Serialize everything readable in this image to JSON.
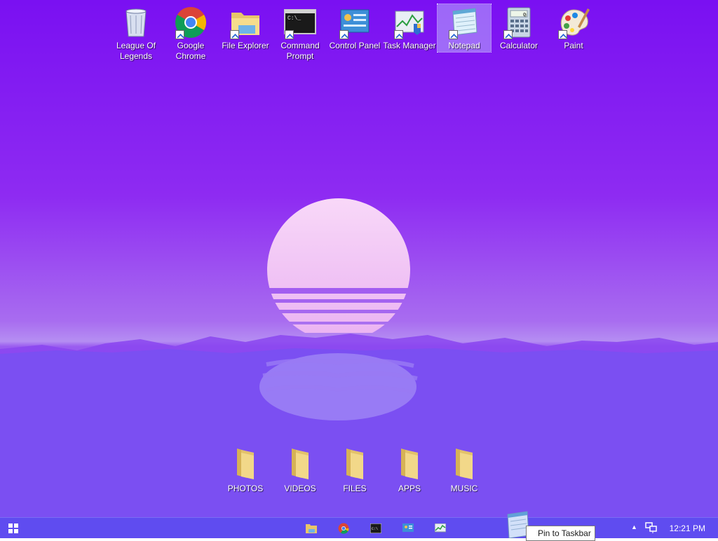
{
  "desktop": {
    "icons": [
      {
        "label": "League Of Legends",
        "icon": "recycle-bin-icon"
      },
      {
        "label": "Google Chrome",
        "icon": "chrome-icon"
      },
      {
        "label": "File Explorer",
        "icon": "file-explorer-icon"
      },
      {
        "label": "Command Prompt",
        "icon": "command-prompt-icon"
      },
      {
        "label": "Control Panel",
        "icon": "control-panel-icon"
      },
      {
        "label": "Task Manager",
        "icon": "task-manager-icon"
      },
      {
        "label": "Notepad",
        "icon": "notepad-icon",
        "selected": true
      },
      {
        "label": "Calculator",
        "icon": "calculator-icon"
      },
      {
        "label": "Paint",
        "icon": "paint-icon"
      }
    ],
    "folders": [
      {
        "label": "PHOTOS"
      },
      {
        "label": "VIDEOS"
      },
      {
        "label": "FILES"
      },
      {
        "label": "APPS"
      },
      {
        "label": "MUSIC"
      }
    ]
  },
  "taskbar": {
    "pinned": [
      "file-explorer-icon",
      "chrome-icon",
      "command-prompt-icon",
      "control-panel-icon",
      "task-manager-icon"
    ],
    "clock": "12:21 PM",
    "tooltip": "Pin to Taskbar"
  },
  "colors": {
    "taskbar": "#5f4cf0",
    "sun": "#f3c8f6",
    "sky_top": "#7a10f2"
  }
}
